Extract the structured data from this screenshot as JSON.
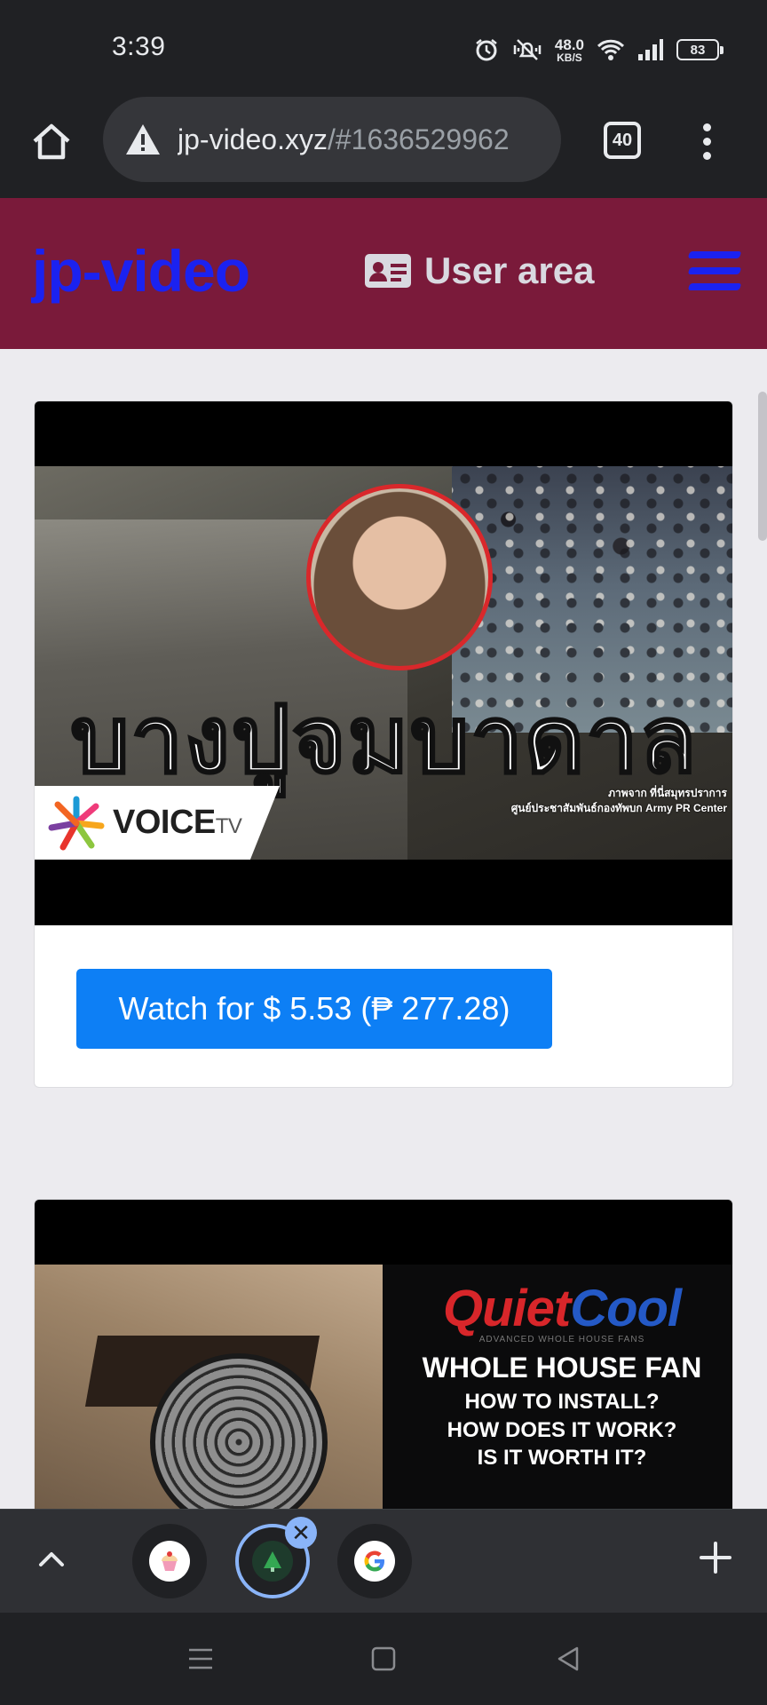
{
  "status_bar": {
    "time": "3:39",
    "net_speed_value": "48.0",
    "net_speed_unit": "KB/S",
    "battery": "83",
    "icons": [
      "alarm-icon",
      "mute-vibrate-icon",
      "wifi-icon",
      "signal-icon",
      "battery-icon"
    ]
  },
  "browser": {
    "url_host": "jp-video.xyz",
    "url_path": "/#1636529962",
    "tab_count": "40",
    "icons": [
      "home-icon",
      "warning-icon",
      "tab-switcher-icon",
      "more-vert-icon"
    ]
  },
  "site": {
    "logo": "jp-video",
    "user_area_label": "User area",
    "colors": {
      "header_bg": "#7a1a3a",
      "logo": "#1b22f0",
      "button": "#0d7ff5"
    }
  },
  "videos": [
    {
      "thumbnail_headline": "บางปูจมบาดาล",
      "badge_brand": "VOICE",
      "badge_suffix": "TV",
      "credit_line_1": "ภาพจาก ที่นี่สมุทรปราการ",
      "credit_line_2": "ศูนย์ประชาสัมพันธ์กองทัพบก Army PR Center",
      "watch_label": "Watch for $ 5.53 (₱ 277.28)"
    },
    {
      "brand_part_1": "Quiet",
      "brand_part_2": "Cool",
      "brand_subtitle": "ADVANCED WHOLE HOUSE FANS",
      "title": "WHOLE HOUSE FAN",
      "line_1": "HOW TO INSTALL?",
      "line_2": "HOW DOES IT WORK?",
      "line_3": "IS IT WORTH IT?"
    }
  ],
  "tab_strip": {
    "close_symbol": "✕",
    "tabs": [
      "cupcake-favicon",
      "tree-favicon",
      "google-favicon"
    ]
  }
}
